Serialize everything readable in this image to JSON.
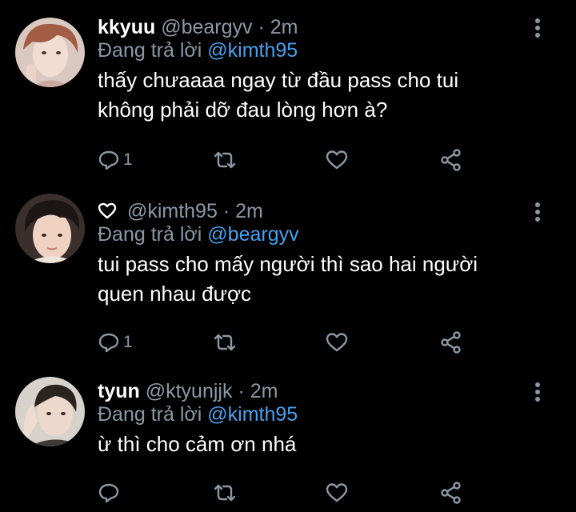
{
  "tweets": [
    {
      "name": "kkyuu",
      "handle": "@beargyv",
      "separator": "·",
      "time": "2m",
      "replying_prefix": "Đang trả lời",
      "replying_to": "@kimth95",
      "text_line1": "thấy chưaaaa ngay từ đầu pass cho tui",
      "text_line2": "không phải dỡ đau lòng hơn à?",
      "reply_count": "1"
    },
    {
      "name": "",
      "handle": "@kimth95",
      "separator": "·",
      "time": "2m",
      "replying_prefix": "Đang trả lời",
      "replying_to": "@beargyv",
      "text_line1": "tui pass cho mấy người thì sao hai người",
      "text_line2": "quen nhau được",
      "reply_count": "1"
    },
    {
      "name": "tyun",
      "handle": "@ktyunjjk",
      "separator": "·",
      "time": "2m",
      "replying_prefix": "Đang trả lời",
      "replying_to": "@kimth95",
      "text_line1": "ừ thì cho cảm ơn nhá",
      "text_line2": "",
      "reply_count": ""
    }
  ],
  "icons": {
    "reply": "reply-icon",
    "retweet": "retweet-icon",
    "like": "heart-icon",
    "share": "share-icon",
    "more": "more-vertical-icon",
    "name_emoji": "heart-outline-icon"
  },
  "colors": {
    "background": "#000000",
    "text": "#ffffff",
    "muted": "#8b98a5",
    "link": "#4aa0ec"
  }
}
